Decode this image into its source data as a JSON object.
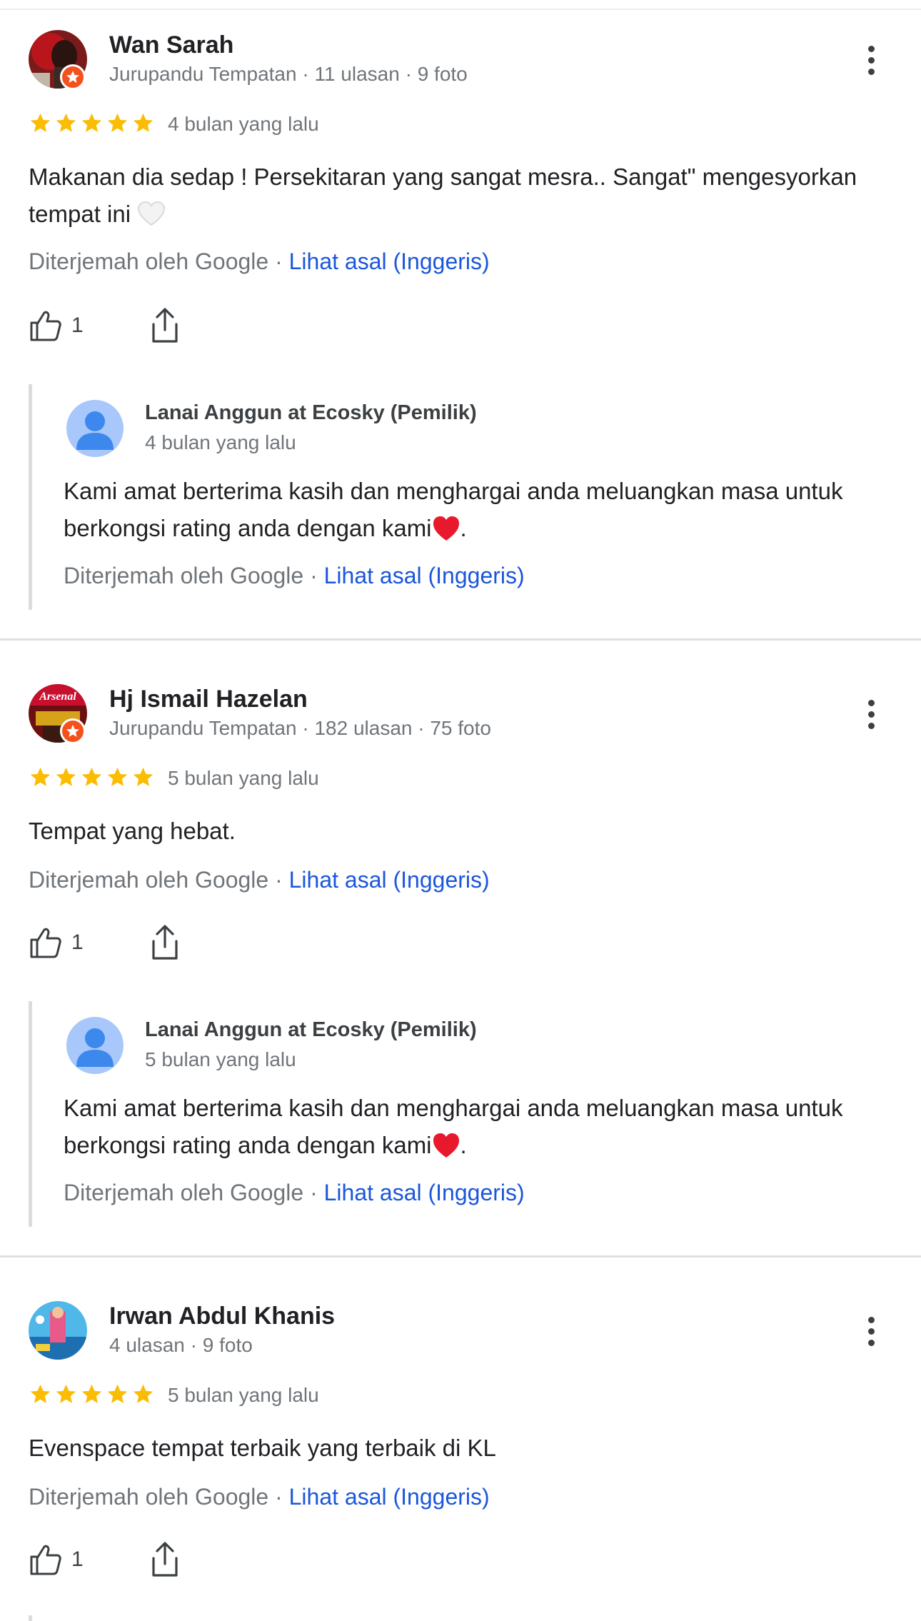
{
  "reviews": [
    {
      "name": "Wan Sarah",
      "meta": "Jurupandu Tempatan · 11 ulasan · 9 foto",
      "rating": 5,
      "when": "4 bulan yang lalu",
      "text": "Makanan dia sedap ! Persekitaran yang sangat mesra.. Sangat\" mengesyorkan tempat ini",
      "text_emoji": "white-heart",
      "translated_by": "Diterjemah oleh Google · ",
      "see_original": "Lihat asal (Inggeris)",
      "likes": "1",
      "reply": {
        "owner": "Lanai Anggun at Ecosky (Pemilik)",
        "when": "4 bulan yang lalu",
        "text": "Kami amat berterima kasih dan menghargai anda meluangkan masa untuk berkongsi rating anda dengan kami",
        "text_end": ".",
        "translated_by": "Diterjemah oleh Google · ",
        "see_original": "Lihat asal (Inggeris)"
      }
    },
    {
      "name": "Hj Ismail Hazelan",
      "meta": "Jurupandu Tempatan · 182 ulasan · 75 foto",
      "rating": 5,
      "when": "5 bulan yang lalu",
      "text": "Tempat yang hebat.",
      "translated_by": "Diterjemah oleh Google · ",
      "see_original": "Lihat asal (Inggeris)",
      "likes": "1",
      "avatar_text": "Arsenal",
      "reply": {
        "owner": "Lanai Anggun at Ecosky (Pemilik)",
        "when": "5 bulan yang lalu",
        "text": "Kami amat berterima kasih dan menghargai anda meluangkan masa untuk berkongsi rating anda dengan kami",
        "text_end": ".",
        "translated_by": "Diterjemah oleh Google · ",
        "see_original": "Lihat asal (Inggeris)"
      }
    },
    {
      "name": "Irwan Abdul Khanis",
      "meta": "4 ulasan · 9 foto",
      "rating": 5,
      "when": "5 bulan yang lalu",
      "text": "Evenspace tempat terbaik yang terbaik di KL",
      "translated_by": "Diterjemah oleh Google · ",
      "see_original": "Lihat asal (Inggeris)",
      "likes": "1"
    }
  ],
  "colors": {
    "star": "#fbbc04",
    "link": "#1a56db",
    "badge": "#f4511e",
    "owner_avatar": "#a8c7fa"
  },
  "icons": [
    "more-vert-icon",
    "thumb-up-icon",
    "share-icon",
    "star-icon",
    "local-guide-badge-icon",
    "owner-avatar-icon"
  ]
}
